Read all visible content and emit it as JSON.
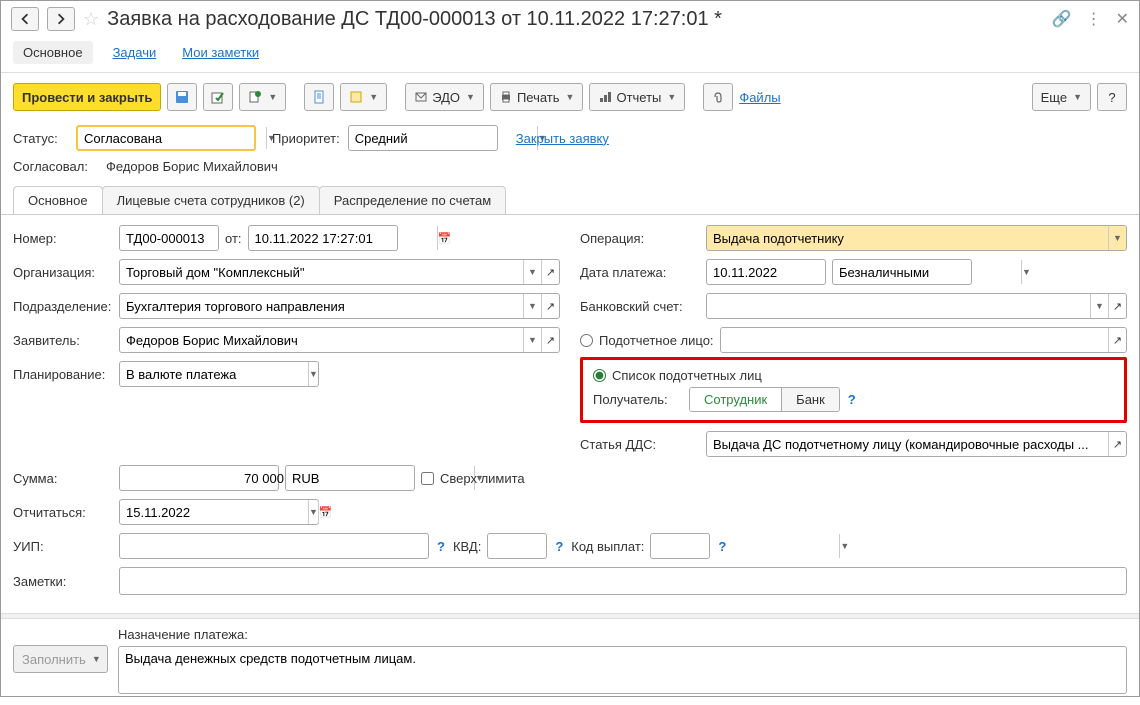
{
  "title": "Заявка на расходование ДС ТД00-000013 от 10.11.2022 17:27:01 *",
  "navtabs": {
    "main": "Основное",
    "tasks": "Задачи",
    "notes": "Мои заметки"
  },
  "toolbar": {
    "post_close": "Провести и закрыть",
    "edo": "ЭДО",
    "print": "Печать",
    "reports": "Отчеты",
    "files": "Файлы",
    "more": "Еще",
    "help": "?"
  },
  "status": {
    "label": "Статус:",
    "value": "Согласована",
    "priority_label": "Приоритет:",
    "priority_value": "Средний",
    "close_link": "Закрыть заявку"
  },
  "approved": {
    "label": "Согласовал:",
    "value": "Федоров Борис Михайлович"
  },
  "subtabs": {
    "main": "Основное",
    "accounts": "Лицевые счета сотрудников (2)",
    "distribution": "Распределение по счетам"
  },
  "left": {
    "number_label": "Номер:",
    "number_value": "ТД00-000013",
    "from_label": "от:",
    "date_value": "10.11.2022 17:27:01",
    "org_label": "Организация:",
    "org_value": "Торговый дом \"Комплексный\"",
    "dept_label": "Подразделение:",
    "dept_value": "Бухгалтерия торгового направления",
    "applicant_label": "Заявитель:",
    "applicant_value": "Федоров Борис Михайлович",
    "planning_label": "Планирование:",
    "planning_value": "В валюте платежа"
  },
  "right": {
    "operation_label": "Операция:",
    "operation_value": "Выдача подотчетнику",
    "payment_date_label": "Дата платежа:",
    "payment_date_value": "10.11.2022",
    "payment_method_value": "Безналичными",
    "bank_account_label": "Банковский счет:",
    "bank_account_value": "",
    "accountable_radio": "Подотчетное лицо:",
    "accountable_value": "",
    "list_radio": "Список подотчетных лиц",
    "recipient_label": "Получатель:",
    "toggle_employee": "Сотрудник",
    "toggle_bank": "Банк",
    "dds_label": "Статья ДДС:",
    "dds_value": "Выдача ДС подотчетному лицу (командировочные расходы ..."
  },
  "sum": {
    "label": "Сумма:",
    "value": "70 000,00",
    "currency": "RUB",
    "over_limit": "Сверх лимита"
  },
  "report_by": {
    "label": "Отчитаться:",
    "value": "15.11.2022"
  },
  "uip": {
    "label": "УИП:",
    "kvd_label": "КВД:",
    "payout_code_label": "Код выплат:"
  },
  "notes": {
    "label": "Заметки:"
  },
  "bottom": {
    "fill": "Заполнить",
    "purpose_label": "Назначение платежа:",
    "purpose_value": "Выдача денежных средств подотчетным лицам."
  }
}
